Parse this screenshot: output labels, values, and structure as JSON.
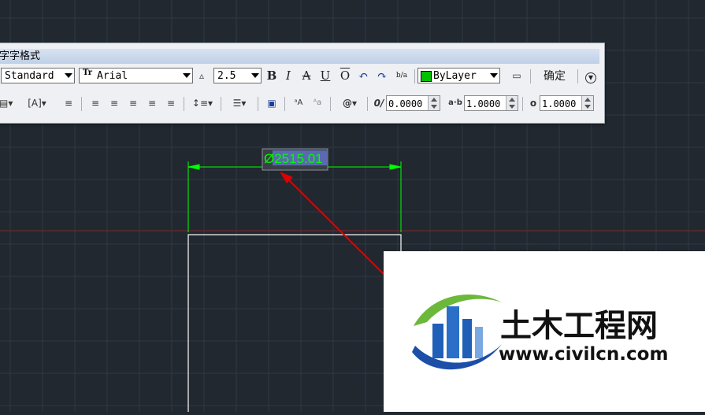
{
  "toolbar": {
    "title": "字字格式",
    "row1": {
      "style_value": "Standard",
      "font_value": "Arial",
      "font_prefix": "Tr",
      "height_value": "2.5",
      "bold": "B",
      "italic": "I",
      "strike": "A",
      "underline": "U",
      "overline": "O",
      "undo": "↶",
      "redo": "↷",
      "stack": "b/a",
      "color_value": "ByLayer",
      "color_swatch": "#00c000",
      "ok_label": "确定",
      "options": "▼"
    },
    "row2": {
      "oblique_value": "0.0000",
      "tracking_value": "1.0000",
      "width_value": "1.0000",
      "at_symbol": "@",
      "oblique_prefix": "0/",
      "tracking_prefix": "a·b",
      "width_prefix": "o"
    }
  },
  "drawing": {
    "dimension_text": "Ø2515.01",
    "dimension_color": "#00ff00",
    "arrow_color": "#e00000"
  },
  "watermark": {
    "title": "土木工程网",
    "url": "www.civilcn.com"
  }
}
